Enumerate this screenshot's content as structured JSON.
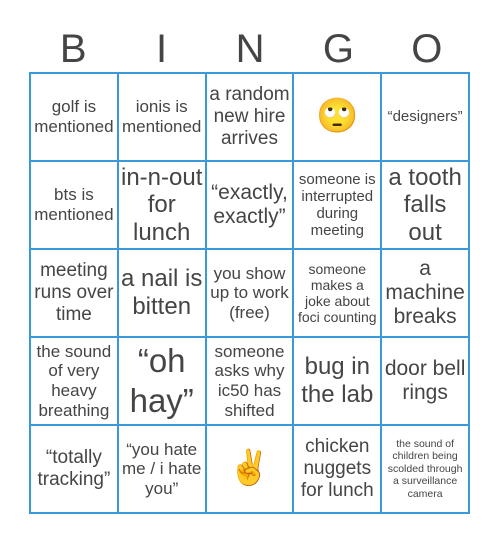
{
  "header": {
    "letters": [
      "B",
      "I",
      "N",
      "G",
      "O"
    ]
  },
  "board": {
    "cells": [
      "golf is mentioned",
      "ionis is mentioned",
      "a random new hire arrives",
      "🙄",
      "“designers”",
      "bts is mentioned",
      "in-n-out for lunch",
      "“exactly, exactly”",
      "someone is interrupted during meeting",
      "a tooth falls out",
      "meeting runs over time",
      "a nail is bitten",
      "you show up to work (free)",
      "someone makes a joke about foci counting",
      "a machine breaks",
      "the sound of very heavy breathing",
      "“oh hay”",
      "someone asks why ic50 has shifted",
      "bug in the lab",
      "door bell rings",
      "“totally tracking”",
      "“you hate me / i hate you”",
      "✌️",
      "chicken nuggets for lunch",
      "the sound of children being scolded through a surveillance camera"
    ]
  },
  "colors": {
    "grid_border": "#3a9ad9",
    "text": "#454545"
  }
}
